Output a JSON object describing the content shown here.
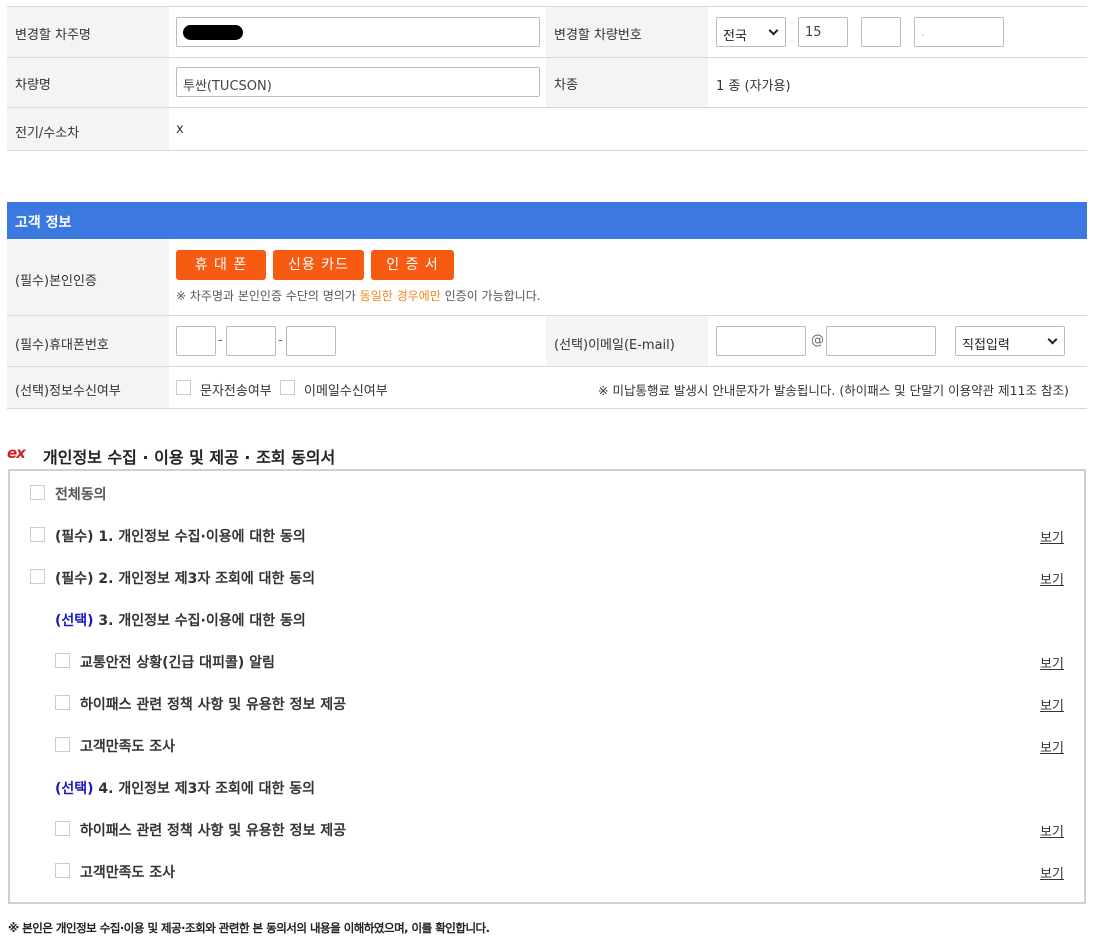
{
  "vehicle": {
    "owner_label": "변경할 차주명",
    "plate_label": "변경할 차량번호",
    "region_value": "전국",
    "plate_part1": "15",
    "plate_part2": "",
    "plate_part3": ".",
    "car_name_label": "차량명",
    "car_name_value": "투싼(TUCSON)",
    "car_type_label": "차종",
    "car_type_value": "1 종 (자가용)",
    "ev_label": "전기/수소차",
    "ev_value": "x"
  },
  "customer": {
    "section_title": "고객 정보",
    "auth_label": "(필수)본인인증",
    "auth_buttons": [
      "휴 대 폰",
      "신용 카드",
      "인 증 서"
    ],
    "auth_note_prefix": "※ 차주명과 본인인증 수단의 명의가 ",
    "auth_note_highlight": "동일한 경우에만",
    "auth_note_suffix": " 인증이 가능합니다.",
    "phone_label": "(필수)휴대폰번호",
    "dash": "-",
    "email_label": "(선택)이메일(E-mail)",
    "at": "@",
    "email_domain_select": "직접입력",
    "receive_label": "(선택)정보수신여부",
    "sms_label": "문자전송여부",
    "email_receive_label": "이메일수신여부",
    "receive_note": "※ 미납통행료 발생시 안내문자가 발송됩니다. (하이패스 및 단말기 이용약관 제11조 참조)"
  },
  "consent": {
    "logo_text": "ex",
    "title": "개인정보 수집 · 이용 및 제공 · 조회 동의서",
    "all_agree": "전체동의",
    "view_label": "보기",
    "item1": "(필수) 1. 개인정보 수집·이용에 대한 동의",
    "item2": "(필수) 2. 개인정보 제3자 조회에 대한 동의",
    "item3_tag": "(선택)",
    "item3": " 3. 개인정보 수집·이용에 대한 동의",
    "item3_sub": [
      "교통안전 상황(긴급 대피콜) 알림",
      "하이패스 관련 정책 사항 및 유용한 정보 제공",
      "고객만족도 조사"
    ],
    "item4_tag": "(선택)",
    "item4": " 4. 개인정보 제3자 조회에 대한 동의",
    "item4_sub": [
      "하이패스 관련 정책 사항 및 유용한 정보 제공",
      "고객만족도 조사"
    ],
    "footer_note": "※ 본인은 개인정보 수집·이용 및 제공·조회와 관련한 본 동의서의 내용을 이해하였으며, 이를 확인합니다."
  },
  "colors": {
    "header_blue": "#3b78e0",
    "button_orange": "#f75b12",
    "highlight_orange": "#f0861a",
    "tag_blue": "#1a1ab8",
    "logo_red": "#d21f26"
  }
}
